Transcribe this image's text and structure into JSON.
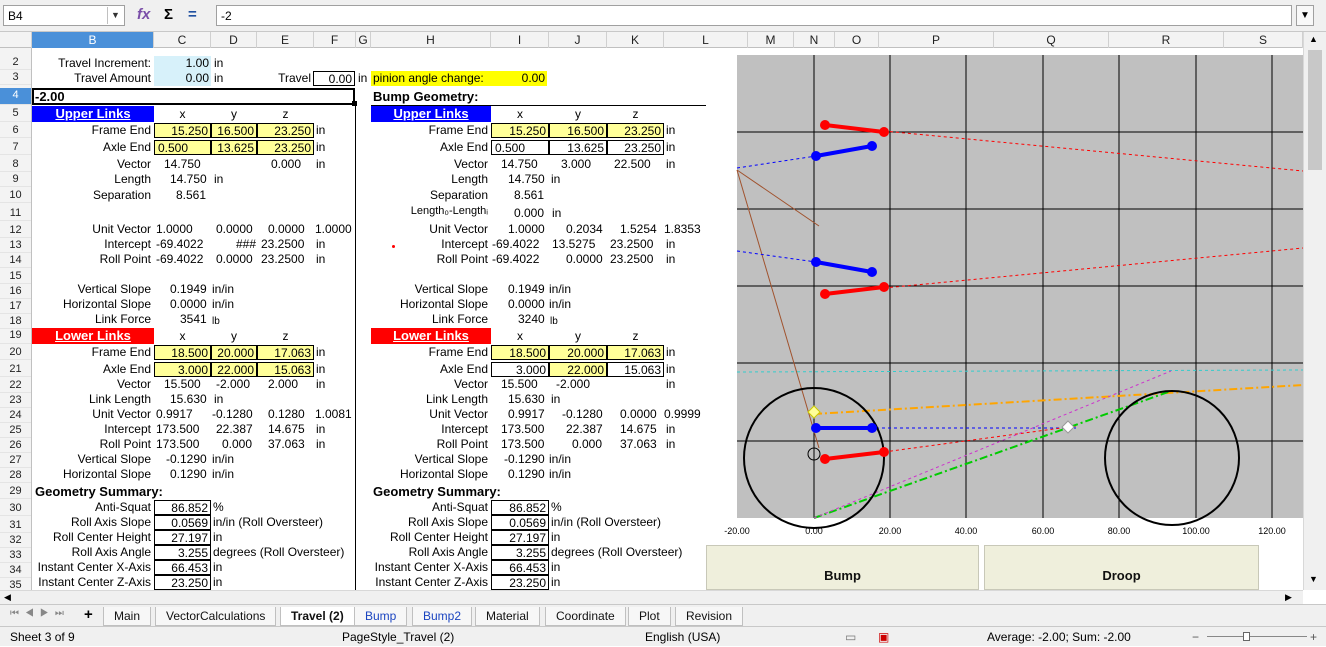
{
  "formula_bar": {
    "cell_ref": "B4",
    "content": "-2",
    "expand_icon": "chevron-down-icon"
  },
  "columns": [
    "B",
    "C",
    "D",
    "E",
    "F",
    "G",
    "H",
    "I",
    "J",
    "K",
    "L",
    "M",
    "N",
    "O",
    "P",
    "Q",
    "R",
    "S"
  ],
  "rows": [
    "2",
    "3",
    "4",
    "5",
    "6",
    "7",
    "8",
    "9",
    "10",
    "11",
    "12",
    "13",
    "14",
    "15",
    "16",
    "17",
    "18",
    "19",
    "20",
    "21",
    "22",
    "23",
    "24",
    "25",
    "26",
    "27",
    "28",
    "29",
    "30",
    "31",
    "32",
    "33",
    "34",
    "35"
  ],
  "left": {
    "travel_increment_label": "Travel Increment:",
    "travel_increment_value": "1.00",
    "travel_increment_unit": "in",
    "travel_amount_label": "Travel Amount",
    "travel_amount_value": "0.00",
    "travel_amount_unit": "in",
    "travel_label": "Travel",
    "travel_value": "0.00",
    "travel_unit": "in",
    "b4_value": "-2.00",
    "upper_links": "Upper Links",
    "x": "x",
    "y": "y",
    "z": "z",
    "frame_end": "Frame End",
    "fe": [
      "15.250",
      "16.500",
      "23.250"
    ],
    "in1": "in",
    "axle_end": "Axle End",
    "ae": [
      "0.500",
      "13.625",
      "23.250"
    ],
    "in2": "in",
    "vector": "Vector",
    "vec": [
      "14.750",
      "0.000"
    ],
    "in3": "in",
    "length": "Length",
    "len": "14.750",
    "in4": "in",
    "separation": "Separation",
    "sep": "8.561",
    "unit_vector": "Unit Vector",
    "uv": [
      "1.0000",
      "0.0000",
      "0.0000",
      "1.0000"
    ],
    "intercept": "Intercept",
    "ic": [
      "-69.4022",
      "###",
      "23.2500"
    ],
    "in5": "in",
    "roll_point": "Roll Point",
    "rp": [
      "-69.4022",
      "0.0000",
      "23.2500"
    ],
    "in6": "in",
    "vertical_slope": "Vertical Slope",
    "vs": "0.1949",
    "inin1": "in/in",
    "horizontal_slope": "Horizontal Slope",
    "hs": "0.0000",
    "inin2": "in/in",
    "link_force": "Link Force",
    "lf": "3541",
    "lb": "lb",
    "lower_links": "Lower Links",
    "lfe": [
      "18.500",
      "20.000",
      "17.063"
    ],
    "in7": "in",
    "lae": [
      "3.000",
      "22.000",
      "15.063"
    ],
    "in8": "in",
    "lvec": [
      "15.500",
      "-2.000",
      "2.000"
    ],
    "in9": "in",
    "link_length": "Link Length",
    "ll": "15.630",
    "in10": "in",
    "luv": [
      "0.9917",
      "-0.1280",
      "0.1280",
      "1.0081"
    ],
    "lic": [
      "173.500",
      "22.387",
      "14.675"
    ],
    "in11": "in",
    "lrp": [
      "173.500",
      "0.000",
      "37.063"
    ],
    "in12": "in",
    "lvs": "-0.1290",
    "inin3": "in/in",
    "lhs": "0.1290",
    "inin4": "in/in",
    "geometry_summary": "Geometry Summary:",
    "anti_squat": "Anti-Squat",
    "as": "86.852",
    "pct": "%",
    "roll_axis_slope": "Roll Axis Slope",
    "ras": "0.0569",
    "ras_unit": "in/in (Roll Oversteer)",
    "roll_center_height": "Roll Center Height",
    "rch": "27.197",
    "in13": "in",
    "roll_axis_angle": "Roll Axis Angle",
    "raa": "3.255",
    "raa_unit": "degrees (Roll Oversteer)",
    "ic_x": "Instant Center X-Axis",
    "icx": "66.453",
    "in14": "in",
    "ic_z": "Instant Center Z-Axis",
    "icz": "23.250",
    "in15": "in"
  },
  "right": {
    "pinion_label": "pinion angle change:",
    "pinion_value": "0.00",
    "bump_geometry": "Bump Geometry:",
    "upper_links": "Upper Links",
    "x": "x",
    "y": "y",
    "z": "z",
    "frame_end": "Frame End",
    "fe": [
      "15.250",
      "16.500",
      "23.250"
    ],
    "in1": "in",
    "axle_end": "Axle End",
    "ae": [
      "0.500",
      "13.625",
      "23.250"
    ],
    "in2": "in",
    "vector": "Vector",
    "vec": [
      "14.750",
      "3.000",
      "22.500"
    ],
    "in3": "in",
    "length": "Length",
    "len": "14.750",
    "in4": "in",
    "separation": "Separation",
    "sep": "8.561",
    "length_diff_label": "Length₀-Lengthᵢ",
    "length_diff": "0.000",
    "in5": "in",
    "unit_vector": "Unit Vector",
    "uv": [
      "1.0000",
      "0.2034",
      "1.5254",
      "1.8353"
    ],
    "intercept": "Intercept",
    "ic": [
      "-69.4022",
      "13.5275",
      "23.2500"
    ],
    "in6": "in",
    "roll_point": "Roll Point",
    "rp": [
      "-69.4022",
      "0.0000",
      "23.2500"
    ],
    "in7": "in",
    "vertical_slope": "Vertical Slope",
    "vs": "0.1949",
    "inin1": "in/in",
    "horizontal_slope": "Horizontal Slope",
    "hs": "0.0000",
    "inin2": "in/in",
    "link_force": "Link Force",
    "lf": "3240",
    "lb": "lb",
    "lower_links": "Lower Links",
    "lfe": [
      "18.500",
      "20.000",
      "17.063"
    ],
    "in8": "in",
    "lae": [
      "3.000",
      "22.000",
      "15.063"
    ],
    "in9": "in",
    "lvec": [
      "15.500",
      "-2.000"
    ],
    "in10": "in",
    "link_length": "Link Length",
    "ll": "15.630",
    "in11": "in",
    "luv": [
      "0.9917",
      "-0.1280",
      "0.0000",
      "0.9999"
    ],
    "lic": [
      "173.500",
      "22.387",
      "14.675"
    ],
    "in12": "in",
    "lrp": [
      "173.500",
      "0.000",
      "37.063"
    ],
    "in13": "in",
    "lvs": "-0.1290",
    "inin3": "in/in",
    "lhs": "0.1290",
    "inin4": "in/in",
    "geometry_summary": "Geometry Summary:",
    "anti_squat": "Anti-Squat",
    "as": "86.852",
    "pct": "%",
    "roll_axis_slope": "Roll Axis Slope",
    "ras": "0.0569",
    "ras_unit": "in/in (Roll Oversteer)",
    "roll_center_height": "Roll Center Height",
    "rch": "27.197",
    "in14": "in",
    "roll_axis_angle": "Roll Axis Angle",
    "raa": "3.255",
    "raa_unit": "degrees (Roll Oversteer)",
    "ic_x": "Instant Center X-Axis",
    "icx": "66.453",
    "in15": "in",
    "ic_z": "Instant Center Z-Axis",
    "icz": "23.250",
    "in16": "in"
  },
  "chart_data": {
    "type": "scatter",
    "x_ticks": [
      "-20.00",
      "0.00",
      "20.00",
      "40.00",
      "60.00",
      "80.00",
      "100.00",
      "120.00"
    ],
    "xlim": [
      -20,
      125
    ],
    "colors": {
      "plot_bg": "#c0c0c0",
      "upper": "#0000ff",
      "lower": "#ff0000",
      "anti_squat": "#ffa500",
      "roll_axis": "#00cc00"
    }
  },
  "buttons": {
    "bump": "Bump",
    "droop": "Droop"
  },
  "tabs": [
    "Main",
    "VectorCalculations",
    "Travel (2)",
    "Bump",
    "Bump2",
    "Material",
    "Coordinate",
    "Plot",
    "Revision"
  ],
  "status": {
    "sheet": "Sheet 3 of 9",
    "page_style": "PageStyle_Travel (2)",
    "language": "English (USA)",
    "summary": "Average: -2.00; Sum: -2.00"
  }
}
